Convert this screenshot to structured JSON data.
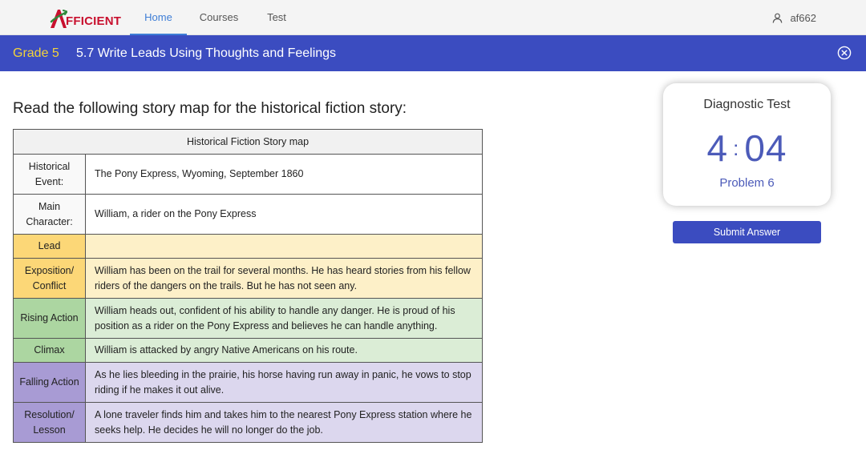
{
  "nav": {
    "logo_text": "FFICIENT",
    "tabs": [
      {
        "label": "Home",
        "active": true
      },
      {
        "label": "Courses",
        "active": false
      },
      {
        "label": "Test",
        "active": false
      }
    ],
    "username": "af662"
  },
  "header": {
    "grade": "Grade 5",
    "lesson_title": "5.7 Write Leads Using Thoughts and Feelings"
  },
  "question": {
    "prompt": "Read the following story map for the historical fiction story:"
  },
  "story_map": {
    "title": "Historical Fiction Story map",
    "rows": [
      {
        "label": "Historical Event:",
        "value": "The Pony Express, Wyoming, September 1860"
      },
      {
        "label": "Main Character:",
        "value": "William, a rider on the Pony Express"
      },
      {
        "label": "Lead",
        "value": ""
      },
      {
        "label": "Exposition/ Conflict",
        "value": "William has been on the trail for several months. He has heard stories from his fellow riders of the dangers on the trails. But he has not seen any."
      },
      {
        "label": "Rising Action",
        "value": "William heads out, confident of his ability to handle any danger. He is proud of his position as a rider on the Pony Express and believes he can handle anything."
      },
      {
        "label": "Climax",
        "value": "William is attacked by angry Native Americans on his route."
      },
      {
        "label": "Falling Action",
        "value": "As he lies bleeding in the prairie, his horse having run away in panic, he vows to stop riding if he makes it out alive."
      },
      {
        "label": "Resolution/ Lesson",
        "value": "A lone traveler finds him and takes him to the nearest Pony Express station where he seeks help. He decides he will no longer do the job."
      }
    ]
  },
  "test_panel": {
    "title": "Diagnostic Test",
    "timer_minutes": "4",
    "timer_separator": ":",
    "timer_seconds": "04",
    "problem_label": "Problem 6",
    "submit_label": "Submit Answer"
  },
  "colors": {
    "header_blue": "#3b4cc0",
    "grade_yellow": "#f2d33b",
    "nav_active": "#3f7ed6",
    "lead_yellow": "#fcd777",
    "action_green": "#acd6a1",
    "falling_purple": "#a89bd4",
    "logo_red": "#c8102e"
  },
  "icons": {
    "logo": "afficient-logo-icon",
    "user": "user-icon",
    "close": "close-circle-icon"
  }
}
